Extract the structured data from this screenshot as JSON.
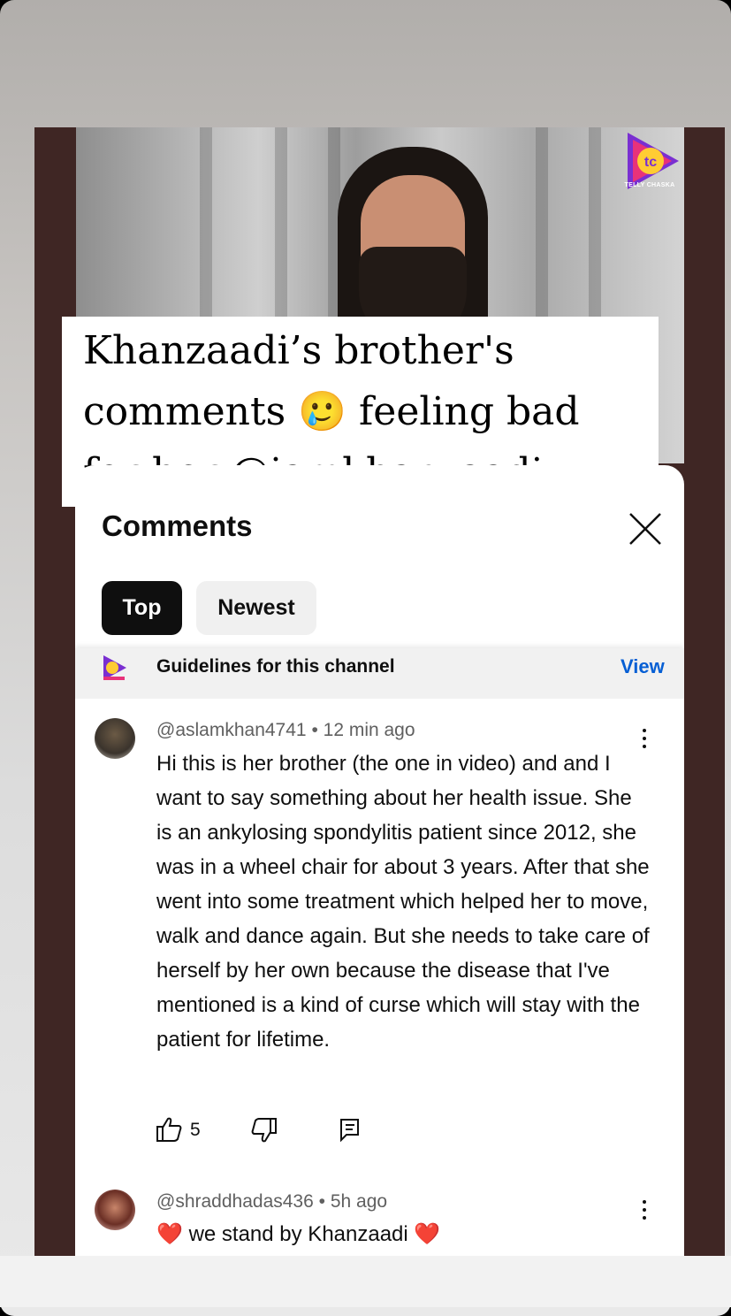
{
  "caption": {
    "line1": "Khanzaadi’s brother's",
    "line2a": "comments",
    "emoji": "🥲",
    "line2b": "feeling bad",
    "line3a": "for her",
    "mention": "@iamkhanzaadi"
  },
  "video": {
    "logo_label": "TELLY CHASKA"
  },
  "comments_panel": {
    "title": "Comments",
    "tabs": [
      {
        "label": "Top",
        "selected": true
      },
      {
        "label": "Newest",
        "selected": false
      }
    ],
    "guidelines": {
      "text": "Guidelines for this channel",
      "action": "View"
    },
    "comments": [
      {
        "author": "@aslamkhan4741",
        "time": "12 min ago",
        "text": "Hi this is her brother (the one in video) and and I want to say something about her health issue. She is an ankylosing spondylitis patient since 2012, she was in a wheel chair for about 3 years. After that she went into some treatment which helped her to move, walk and dance again. But she needs to take care of herself by her own because the disease that I've mentioned is a kind of curse which will stay with the patient for lifetime.",
        "likes": "5"
      },
      {
        "author": "@shraddhadas436",
        "time": "5h ago",
        "text": "we stand by Khanzaadi",
        "emoji": "❤️"
      }
    ],
    "separator": "•"
  },
  "colors": {
    "accent_link": "#065fd4",
    "chip_selected": "#0f0f0f",
    "frame_bg": "#3f2624",
    "heart": "#e0121b"
  },
  "icons": [
    "close-icon",
    "thumbs-up-icon",
    "thumbs-down-icon",
    "reply-icon",
    "more-vert-icon",
    "channel-logo-icon"
  ]
}
